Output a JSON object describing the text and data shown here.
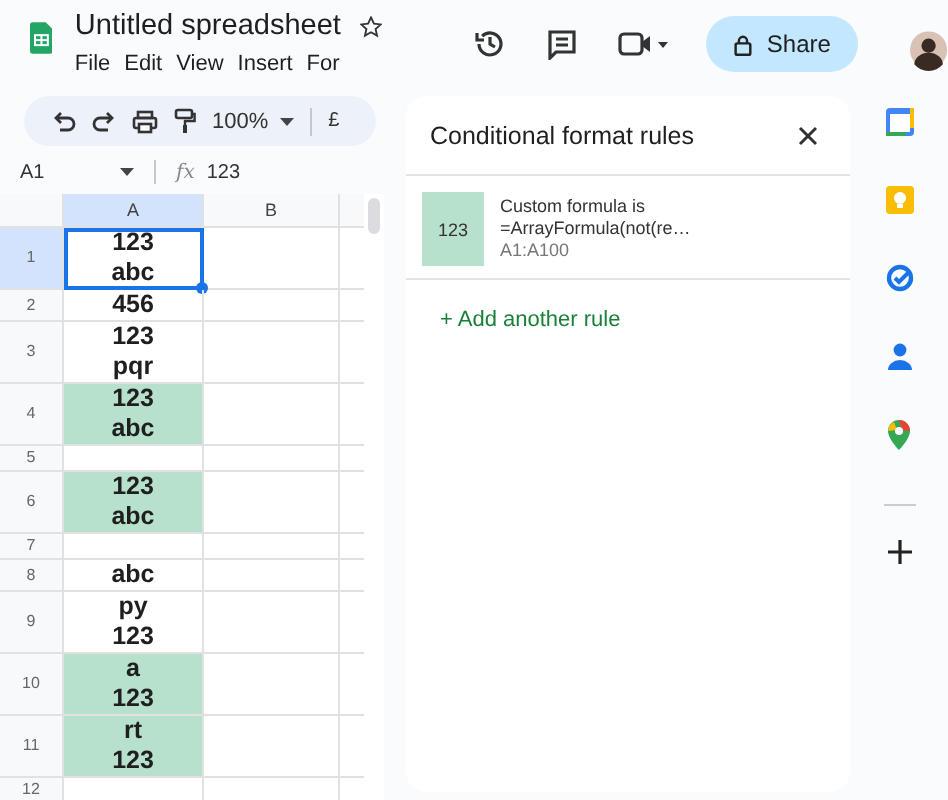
{
  "document": {
    "title": "Untitled spreadsheet"
  },
  "menu": [
    "File",
    "Edit",
    "View",
    "Insert",
    "For"
  ],
  "share_button": {
    "label": "Share"
  },
  "toolbar": {
    "zoom": "100%",
    "currency": "£"
  },
  "formula_bar": {
    "cell_ref": "A1",
    "fx": "fx",
    "value": "123"
  },
  "columns": [
    "A",
    "B"
  ],
  "rows": [
    {
      "number": "1",
      "value": "123\nabc",
      "highlighted": false,
      "selected": true
    },
    {
      "number": "2",
      "value": "456",
      "highlighted": false,
      "selected": false
    },
    {
      "number": "3",
      "value": "123\npqr",
      "highlighted": false,
      "selected": false
    },
    {
      "number": "4",
      "value": "123\nabc",
      "highlighted": true,
      "selected": false
    },
    {
      "number": "5",
      "value": "",
      "highlighted": false,
      "selected": false
    },
    {
      "number": "6",
      "value": "123\nabc",
      "highlighted": true,
      "selected": false
    },
    {
      "number": "7",
      "value": "",
      "highlighted": false,
      "selected": false
    },
    {
      "number": "8",
      "value": "abc",
      "highlighted": false,
      "selected": false
    },
    {
      "number": "9",
      "value": "py\n123",
      "highlighted": false,
      "selected": false
    },
    {
      "number": "10",
      "value": "a\n123",
      "highlighted": true,
      "selected": false
    },
    {
      "number": "11",
      "value": "rt\n123",
      "highlighted": true,
      "selected": false
    },
    {
      "number": "12",
      "value": "",
      "highlighted": false,
      "selected": false
    }
  ],
  "panel": {
    "title": "Conditional format rules",
    "rules": [
      {
        "preview": "123",
        "color": "#b7e1cd",
        "condition": "Custom formula is",
        "formula": "=ArrayFormula(not(re…",
        "range": "A1:A100"
      }
    ],
    "add_rule": "+ Add another rule"
  }
}
